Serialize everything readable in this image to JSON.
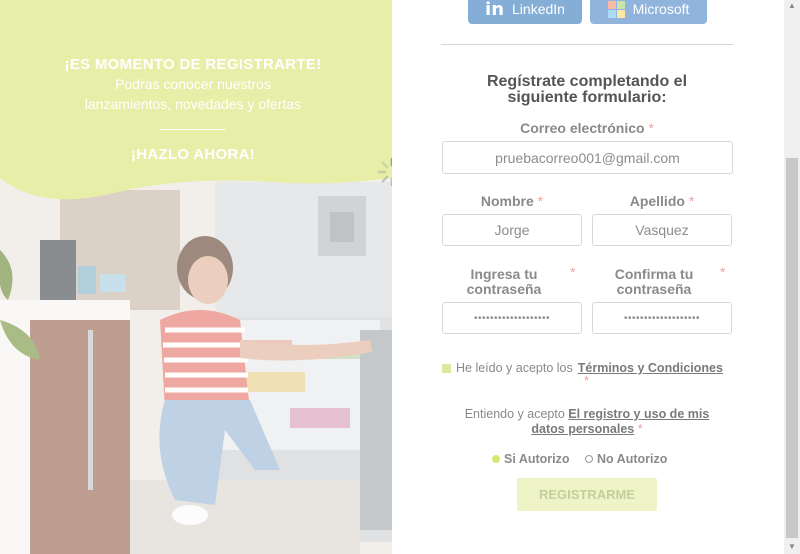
{
  "promo": {
    "title": "¡ES MOMENTO DE REGISTRARTE!",
    "subtitle_line1": "Podras conocer nuestros",
    "subtitle_line2": "lanzamientos, novedades y ofertas",
    "cta": "¡HAZLO AHORA!",
    "accent_color": "#d4e46a"
  },
  "social": {
    "linkedin_label": "LinkedIn",
    "microsoft_label": "Microsoft"
  },
  "form": {
    "title": "Regístrate completando el siguiente formulario:",
    "required_mark": "*",
    "email": {
      "label": "Correo electrónico",
      "value": "pruebacorreo001@gmail.com"
    },
    "first_name": {
      "label": "Nombre",
      "value": "Jorge"
    },
    "last_name": {
      "label": "Apellido",
      "value": "Vasquez"
    },
    "password": {
      "label": "Ingresa tu contraseña",
      "value": "•••••••••••••••••••"
    },
    "password_confirm": {
      "label": "Confirma tu contraseña",
      "value": "•••••••••••••••••••"
    },
    "terms": {
      "prefix": "He leído y acepto los",
      "link": "Términos y Condiciones",
      "checked": true
    },
    "data_consent": {
      "prefix": "Entiendo y acepto",
      "link": "El registro y uso de mis datos personales"
    },
    "authorize_options": [
      {
        "label": "Si Autorizo",
        "selected": true
      },
      {
        "label": "No Autorizo",
        "selected": false
      }
    ],
    "submit_label": "REGISTRARME",
    "submit_color": "#eef4c8"
  }
}
